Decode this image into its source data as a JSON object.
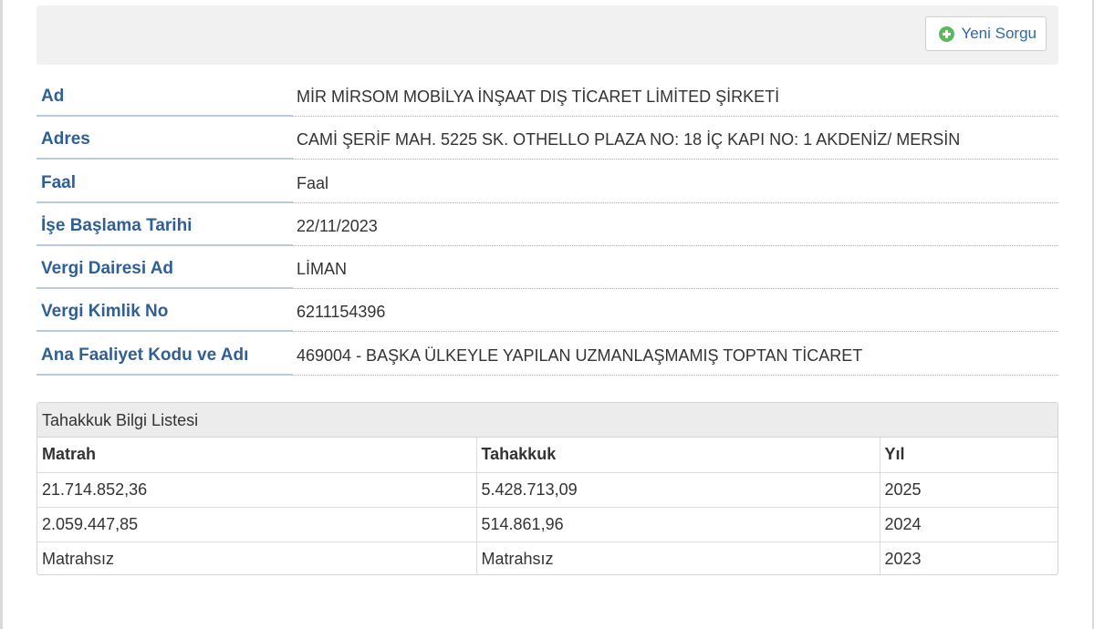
{
  "toolbar": {
    "new_query_label": "Yeni Sorgu",
    "new_query_icon": "plus-circle-icon"
  },
  "info": [
    {
      "key": "name",
      "label": "Ad",
      "value": "MİR MİRSOM MOBİLYA İNŞAAT DIŞ TİCARET LİMİTED ŞİRKETİ"
    },
    {
      "key": "address",
      "label": "Adres",
      "value": "CAMİ ŞERİF MAH. 5225 SK. OTHELLO PLAZA NO: 18 İÇ KAPI NO: 1 AKDENİZ/ MERSİN"
    },
    {
      "key": "status",
      "label": "Faal",
      "value": "Faal"
    },
    {
      "key": "start-date",
      "label": "İşe Başlama Tarihi",
      "value": "22/11/2023"
    },
    {
      "key": "tax-office",
      "label": "Vergi Dairesi Ad",
      "value": "LİMAN"
    },
    {
      "key": "tax-id",
      "label": "Vergi Kimlik No",
      "value": "6211154396"
    },
    {
      "key": "activity",
      "label": "Ana Faaliyet Kodu ve Adı",
      "value": "469004 - BAŞKA ÜLKEYLE YAPILAN UZMANLAŞMAMIŞ TOPTAN TİCARET"
    }
  ],
  "accrual": {
    "title": "Tahakkuk Bilgi Listesi",
    "columns": [
      "Matrah",
      "Tahakkuk",
      "Yıl"
    ],
    "rows": [
      [
        "21.714.852,36",
        "5.428.713,09",
        "2025"
      ],
      [
        "2.059.447,85",
        "514.861,96",
        "2024"
      ],
      [
        "Matrahsız",
        "Matrahsız",
        "2023"
      ]
    ]
  },
  "colors": {
    "label_blue": "#2f5f95",
    "button_text": "#2f6aa3",
    "icon_green": "#5cb85c",
    "toolbar_bg": "#f1f1f1",
    "panel_heading_bg": "#ececec"
  }
}
